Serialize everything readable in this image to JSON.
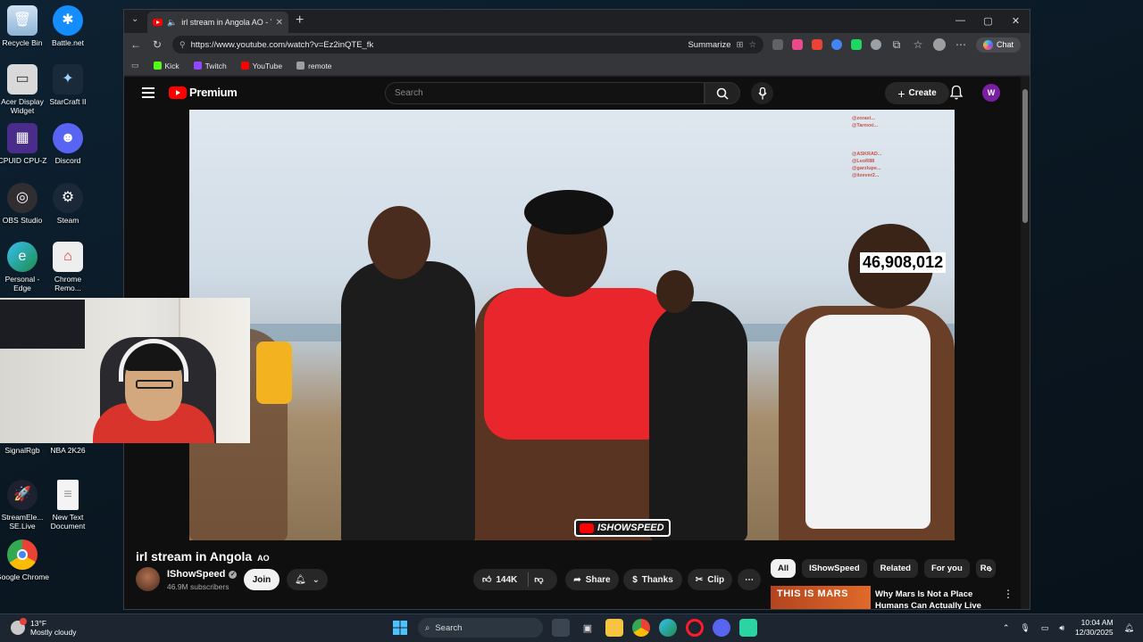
{
  "desktop": {
    "icons_col1": [
      "Recycle Bin",
      "Acer Display Widget",
      "CPUID CPU-Z",
      "OBS Studio",
      "Personal - Edge",
      "SignalRgb",
      "StreamEle... SE.Live",
      "Google Chrome"
    ],
    "icons_col2": [
      "Battle.net",
      "StarCraft II",
      "Discord",
      "Steam",
      "Chrome Remo...",
      "NBA 2K26",
      "New Text Document"
    ]
  },
  "browser": {
    "tab_title": "irl stream in Angola AO - YouTube",
    "url": "https://www.youtube.com/watch?v=Ez2inQTE_fk",
    "summarize_label": "Summarize",
    "chat_label": "Chat",
    "bookmarks": [
      {
        "label": "Kick",
        "color": "#53fc18"
      },
      {
        "label": "Twitch",
        "color": "#9146ff"
      },
      {
        "label": "YouTube",
        "color": "#ff0000"
      },
      {
        "label": "remote",
        "color": "#9aa0a6"
      }
    ]
  },
  "youtube": {
    "logo_text": "Premium",
    "search_placeholder": "Search",
    "create_label": "Create",
    "avatar_letter": "W",
    "video": {
      "title": "irl stream in Angola",
      "title_flag": "AO",
      "overlay_counter": "46,908,012",
      "watermark": "ISHOWSPEED",
      "chat_names": [
        "@zoraxi...",
        "@Tarnxxi...",
        "@ASKRAD...",
        "@LeoR88",
        "@garzlupe...",
        "@itzever2..."
      ]
    },
    "channel": {
      "name": "IShowSpeed",
      "subscribers": "46.9M subscribers",
      "join_label": "Join"
    },
    "actions": {
      "likes": "144K",
      "share": "Share",
      "thanks": "Thanks",
      "clip": "Clip"
    },
    "chips": [
      "All",
      "IShowSpeed",
      "Related",
      "For you",
      "Re"
    ],
    "recommendation": {
      "thumb_text": "THIS IS MARS",
      "title": "Why Mars Is Not a Place Humans Can Actually Live"
    }
  },
  "taskbar": {
    "temperature": "13°F",
    "condition": "Mostly cloudy",
    "search_label": "Search",
    "time": "10:04 AM",
    "date": "12/30/2025"
  }
}
